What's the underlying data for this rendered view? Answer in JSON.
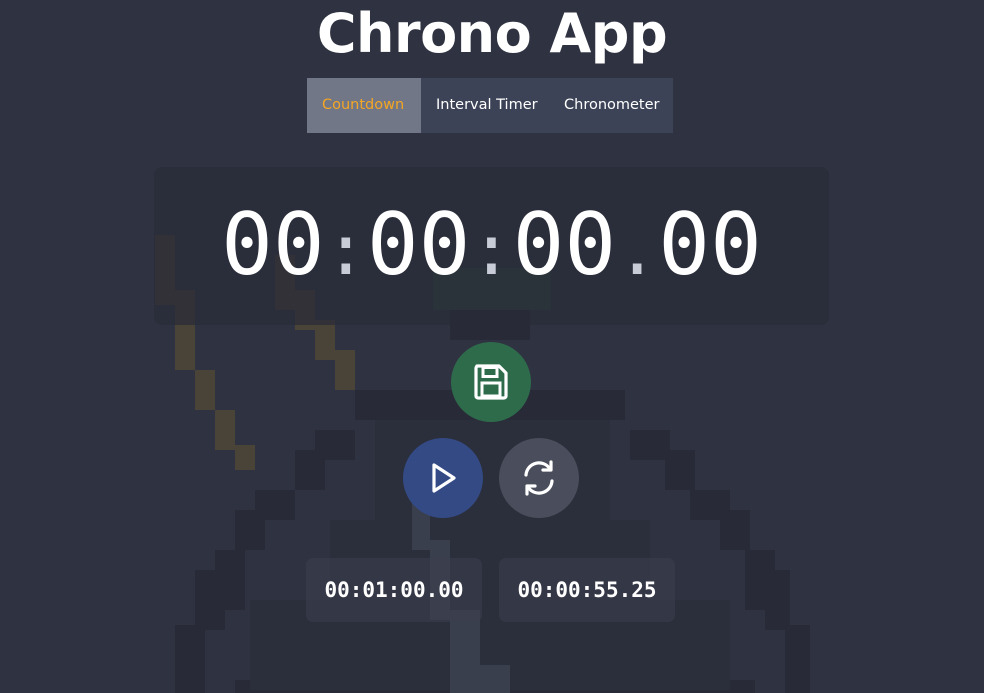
{
  "app": {
    "title": "Chrono App"
  },
  "tabs": [
    {
      "label": "Countdown",
      "active": true
    },
    {
      "label": "Interval Timer",
      "active": false
    },
    {
      "label": "Chronometer",
      "active": false
    }
  ],
  "display": {
    "hours": "00",
    "minutes": "00",
    "seconds": "00",
    "hundredths": "00",
    "sep_colon": ":",
    "sep_dot": "."
  },
  "controls": {
    "save_icon": "save-icon",
    "play_icon": "play-icon",
    "reset_icon": "refresh-icon"
  },
  "times": [
    {
      "value": "00:01:00.00"
    },
    {
      "value": "00:00:55.25"
    }
  ],
  "colors": {
    "background": "#2f3241",
    "active_tab_text": "#f5a623",
    "save_button": "#2e6b4b",
    "play_button": "#334a85",
    "reset_button": "#4a4e5c"
  }
}
